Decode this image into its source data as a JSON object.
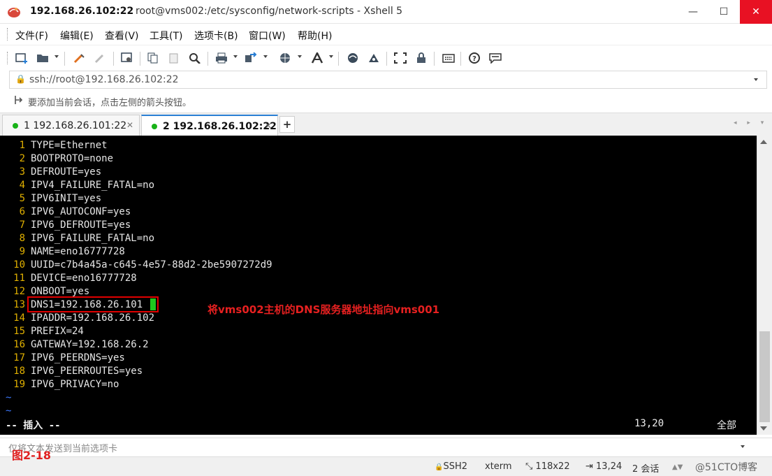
{
  "title": {
    "host": "192.168.26.102:22",
    "path": "root@vms002:/etc/sysconfig/network-scripts - Xshell 5"
  },
  "window_controls": {
    "minimize": "—",
    "maximize": "☐",
    "close": "✕"
  },
  "menu": [
    "文件(F)",
    "编辑(E)",
    "查看(V)",
    "工具(T)",
    "选项卡(B)",
    "窗口(W)",
    "帮助(H)"
  ],
  "address": {
    "value": "ssh://root@192.168.26.102:22"
  },
  "hint": "要添加当前会话，点击左侧的箭头按钮。",
  "tabs": [
    {
      "label": "1 192.168.26.101:22",
      "active": false
    },
    {
      "label": "2 192.168.26.102:22",
      "active": true
    }
  ],
  "tab_add": "+",
  "tab_nav": "◂ ▸ ▾",
  "terminal": {
    "lines": [
      {
        "n": "1",
        "t": "TYPE=Ethernet"
      },
      {
        "n": "2",
        "t": "BOOTPROTO=none"
      },
      {
        "n": "3",
        "t": "DEFROUTE=yes"
      },
      {
        "n": "4",
        "t": "IPV4_FAILURE_FATAL=no"
      },
      {
        "n": "5",
        "t": "IPV6INIT=yes"
      },
      {
        "n": "6",
        "t": "IPV6_AUTOCONF=yes"
      },
      {
        "n": "7",
        "t": "IPV6_DEFROUTE=yes"
      },
      {
        "n": "8",
        "t": "IPV6_FAILURE_FATAL=no"
      },
      {
        "n": "9",
        "t": "NAME=eno16777728"
      },
      {
        "n": "10",
        "t": "UUID=c7b4a45a-c645-4e57-88d2-2be5907272d9"
      },
      {
        "n": "11",
        "t": "DEVICE=eno16777728"
      },
      {
        "n": "12",
        "t": "ONBOOT=yes"
      },
      {
        "n": "13",
        "t": "DNS1=192.168.26.101"
      },
      {
        "n": "14",
        "t": "IPADDR=192.168.26.102"
      },
      {
        "n": "15",
        "t": "PREFIX=24"
      },
      {
        "n": "16",
        "t": "GATEWAY=192.168.26.2"
      },
      {
        "n": "17",
        "t": "IPV6_PEERDNS=yes"
      },
      {
        "n": "18",
        "t": "IPV6_PEERROUTES=yes"
      },
      {
        "n": "19",
        "t": "IPV6_PRIVACY=no"
      }
    ],
    "tildes": [
      "~",
      "~"
    ],
    "annotation": "将vms002主机的DNS服务器地址指向vms001",
    "mode": "-- 插入 --",
    "position": "13,20",
    "percent": "全部",
    "colors": {
      "background": "#000000",
      "line_number": "#e0b000",
      "tilde": "#3c78ff",
      "cursor": "#1ec81e",
      "highlight": "#e00000"
    }
  },
  "send_bar": {
    "placeholder": "仅将文本发送到当前选项卡"
  },
  "figure_label": "图2-18",
  "status": {
    "protocol": "SSH2",
    "terminal": "xterm",
    "size": "118x22",
    "cursor_pos": "13,24",
    "sessions": "2 会话",
    "watermark": "@51CTO博客"
  }
}
